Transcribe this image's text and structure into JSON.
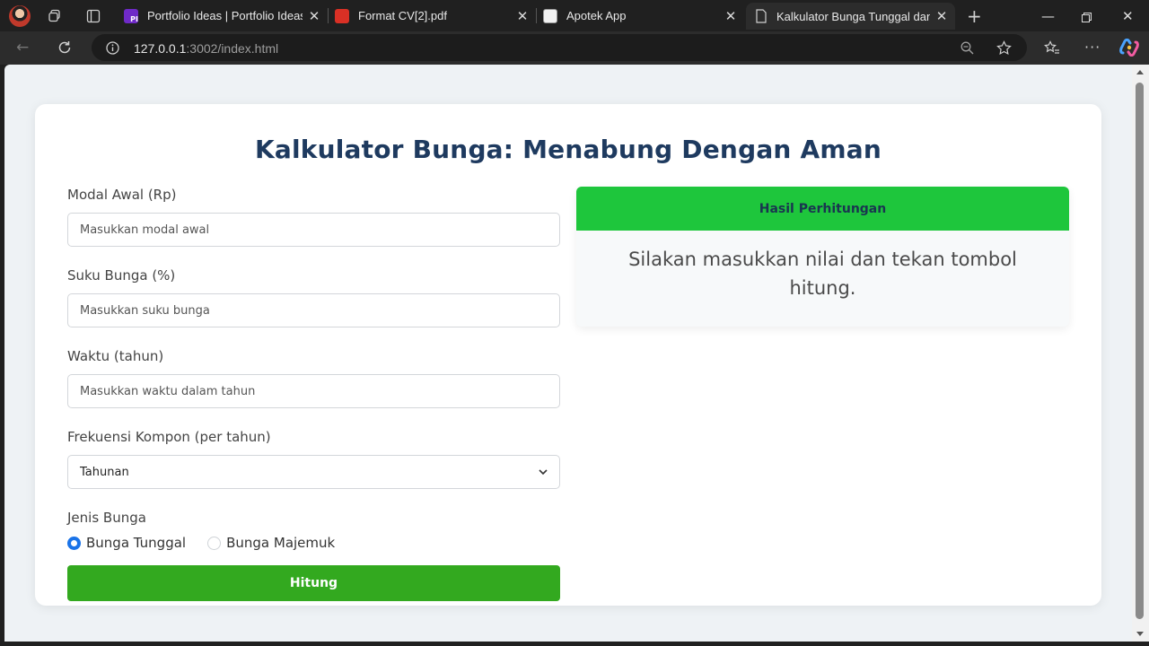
{
  "browser": {
    "tabs": [
      {
        "title": "Portfolio Ideas | Portfolio Ideas",
        "favicon": "portfolio-favicon"
      },
      {
        "title": "Format CV[2].pdf",
        "favicon": "pdf-favicon"
      },
      {
        "title": "Apotek App",
        "favicon": "app-favicon"
      },
      {
        "title": "Kalkulator Bunga Tunggal dan M",
        "favicon": "page-favicon",
        "active": true
      }
    ],
    "url_host": "127.0.0.1",
    "url_rest": ":3002/index.html"
  },
  "page": {
    "title": "Kalkulator Bunga: Menabung Dengan Aman",
    "form": {
      "modal_label": "Modal Awal (Rp)",
      "modal_placeholder": "Masukkan modal awal",
      "bunga_label": "Suku Bunga (%)",
      "bunga_placeholder": "Masukkan suku bunga",
      "waktu_label": "Waktu (tahun)",
      "waktu_placeholder": "Masukkan waktu dalam tahun",
      "frekuensi_label": "Frekuensi Kompon (per tahun)",
      "frekuensi_value": "Tahunan",
      "jenis_label": "Jenis Bunga",
      "radio_tunggal": "Bunga Tunggal",
      "radio_majemuk": "Bunga Majemuk",
      "selected_jenis": "Bunga Tunggal",
      "submit_label": "Hitung"
    },
    "result": {
      "header": "Hasil Perhitungan",
      "message": "Silakan masukkan nilai dan tekan tombol hitung."
    }
  },
  "colors": {
    "title": "#1e3a5f",
    "button": "#33a91f",
    "result_header": "#1ec63c",
    "radio_accent": "#1a73e8"
  }
}
